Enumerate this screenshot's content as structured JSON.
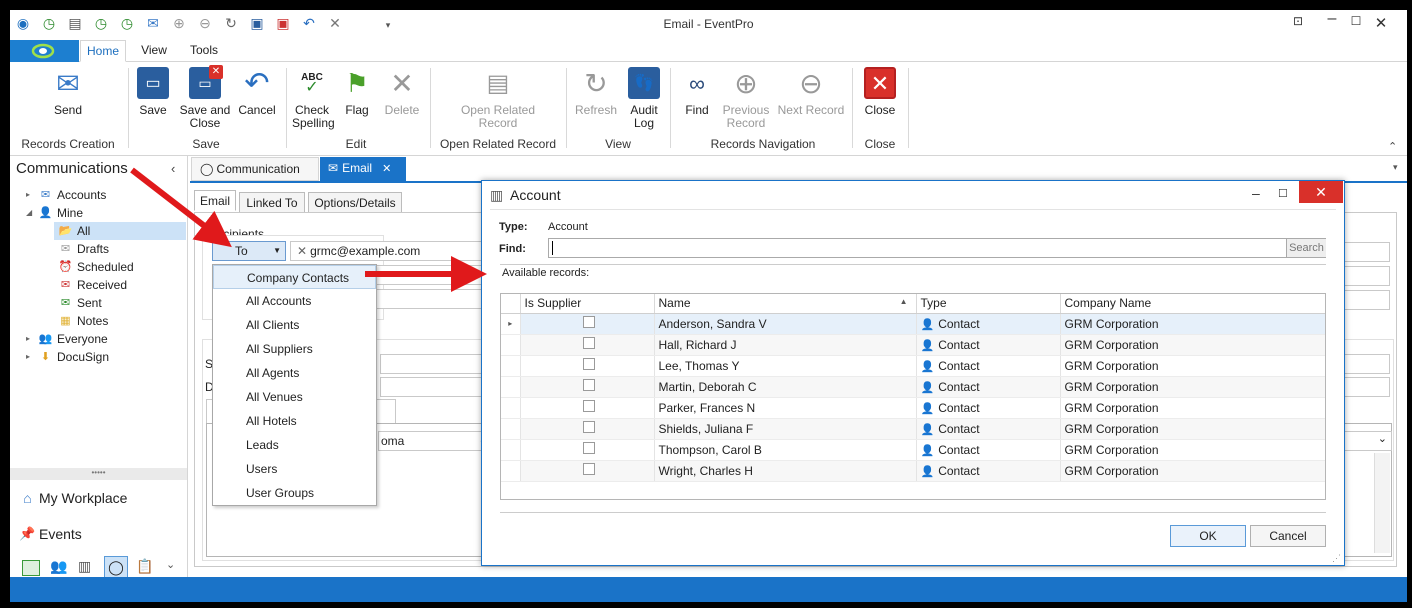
{
  "window": {
    "title": "Email - EventPro"
  },
  "ribbon_tabs": [
    "Home",
    "View",
    "Tools"
  ],
  "ribbon": {
    "send": "Send",
    "save": "Save",
    "save_close_1": "Save and",
    "save_close_2": "Close",
    "cancel": "Cancel",
    "check_1": "Check",
    "check_2": "Spelling",
    "abc": "ABC",
    "flag": "Flag",
    "delete": "Delete",
    "open_related_1": "Open Related",
    "open_related_2": "Record",
    "refresh": "Refresh",
    "audit_1": "Audit",
    "audit_2": "Log",
    "find": "Find",
    "previous_1": "Previous",
    "previous_2": "Record",
    "next": "Next Record",
    "close": "Close",
    "groups": [
      "Records Creation",
      "Save",
      "Edit",
      "Open Related Record",
      "View",
      "Records Navigation",
      "Close"
    ]
  },
  "nav": {
    "title": "Communications",
    "accounts": "Accounts",
    "mine": "Mine",
    "all": "All",
    "drafts": "Drafts",
    "scheduled": "Scheduled",
    "received": "Received",
    "sent": "Sent",
    "notes": "Notes",
    "everyone": "Everyone",
    "docusign": "DocuSign",
    "my_workplace": "My Workplace",
    "events": "Events",
    "grip": "•••••"
  },
  "doc_tabs": {
    "communication": "Communication",
    "email": "Email"
  },
  "form": {
    "tabs": [
      "Email",
      "Linked To",
      "Options/Details"
    ],
    "recipients_label": "Recipients",
    "to_button": "To",
    "recipient_chip": "grmc@example.com",
    "subject_label_partial": "S",
    "date_label_partial": "D",
    "font_partial": "oma"
  },
  "dropdown": [
    "Company Contacts",
    "All Accounts",
    "All Clients",
    "All Suppliers",
    "All Agents",
    "All Venues",
    "All Hotels",
    "Leads",
    "Users",
    "User Groups"
  ],
  "dialog": {
    "title": "Account",
    "type_label": "Type:",
    "type_value": "Account",
    "find_label": "Find:",
    "find_value": "",
    "search_button": "Search",
    "available_label": "Available records:",
    "columns": [
      "Is Supplier",
      "Name",
      "Type",
      "Company Name"
    ],
    "rows": [
      {
        "is_supplier": false,
        "name": "Anderson, Sandra V",
        "type": "Contact",
        "company": "GRM Corporation"
      },
      {
        "is_supplier": false,
        "name": "Hall, Richard J",
        "type": "Contact",
        "company": "GRM Corporation"
      },
      {
        "is_supplier": false,
        "name": "Lee, Thomas Y",
        "type": "Contact",
        "company": "GRM Corporation"
      },
      {
        "is_supplier": false,
        "name": "Martin, Deborah C",
        "type": "Contact",
        "company": "GRM Corporation"
      },
      {
        "is_supplier": false,
        "name": "Parker, Frances N",
        "type": "Contact",
        "company": "GRM Corporation"
      },
      {
        "is_supplier": false,
        "name": "Shields, Juliana F",
        "type": "Contact",
        "company": "GRM Corporation"
      },
      {
        "is_supplier": false,
        "name": "Thompson, Carol B",
        "type": "Contact",
        "company": "GRM Corporation"
      },
      {
        "is_supplier": false,
        "name": "Wright, Charles H",
        "type": "Contact",
        "company": "GRM Corporation"
      }
    ],
    "ok": "OK",
    "cancel": "Cancel"
  },
  "colors": {
    "accent": "#1a73c8",
    "arrow": "#e0191b",
    "close_red": "#d9302a"
  }
}
